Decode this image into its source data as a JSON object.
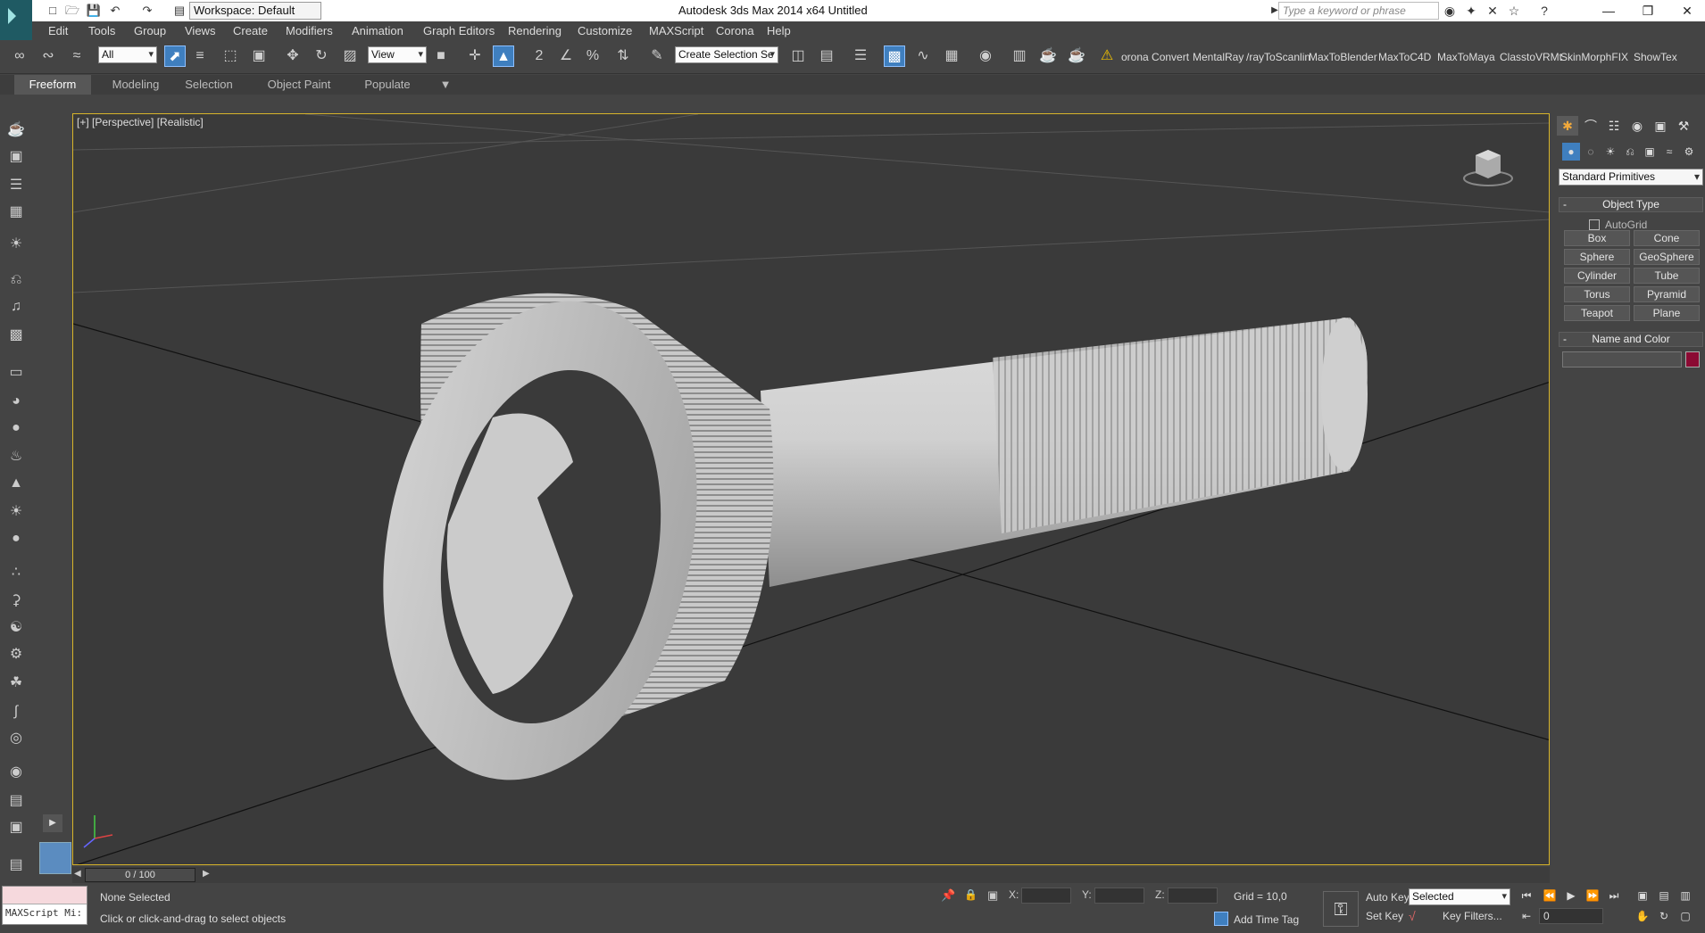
{
  "window": {
    "title": "Autodesk 3ds Max  2014 x64     Untitled",
    "workspace": "Workspace: Default",
    "search_placeholder": "Type a keyword or phrase"
  },
  "menu": [
    "Edit",
    "Tools",
    "Group",
    "Views",
    "Create",
    "Modifiers",
    "Animation",
    "Graph Editors",
    "Rendering",
    "Customize",
    "MAXScript",
    "Corona",
    "Help"
  ],
  "toolbar": {
    "selection_filter": "All",
    "ref_coord": "View",
    "named_selection": "Create Selection Se",
    "plugins": [
      "orona Convert",
      "MentalRay",
      "/rayToScanlin",
      "MaxToBlender",
      "MaxToC4D",
      "MaxToMaya",
      "ClasstoVRMt",
      "SkinMorphFIX",
      "ShowTex"
    ]
  },
  "ribbon": {
    "tabs": [
      "Freeform",
      "Modeling",
      "Selection",
      "Object Paint",
      "Populate"
    ]
  },
  "viewport": {
    "label": "[+] [Perspective] [Realistic]"
  },
  "command_panel": {
    "dropdown": "Standard Primitives",
    "object_type_title": "Object Type",
    "autogrid": "AutoGrid",
    "buttons": [
      "Box",
      "Cone",
      "Sphere",
      "GeoSphere",
      "Cylinder",
      "Tube",
      "Torus",
      "Pyramid",
      "Teapot",
      "Plane"
    ],
    "name_color_title": "Name and Color",
    "color": "#8b0a33"
  },
  "timeline": {
    "frame": "0 / 100"
  },
  "status": {
    "maxscript": "MAXScript Mi:",
    "selection": "None Selected",
    "prompt": "Click or click-and-drag to select objects",
    "x_label": "X:",
    "y_label": "Y:",
    "z_label": "Z:",
    "grid": "Grid = 10,0",
    "add_time_tag": "Add Time Tag",
    "auto_key": "Auto Key",
    "set_key": "Set Key",
    "key_mode": "Selected",
    "key_filters": "Key Filters...",
    "frame_field": "0"
  }
}
